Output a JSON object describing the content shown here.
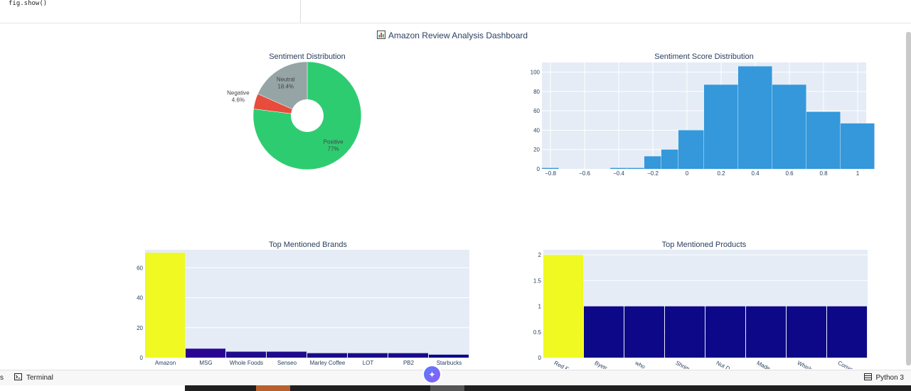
{
  "code": {
    "line": "fig.show()"
  },
  "left_marker": "-",
  "dashboard": {
    "title": "Amazon Review Analysis Dashboard",
    "title_icon": "bar-chart-icon"
  },
  "status_bar": {
    "left_fragment": "s",
    "terminal_label": "Terminal",
    "kernel_label": "Python 3",
    "copilot_icon": "sparkle-icon"
  },
  "chart_data": [
    {
      "type": "pie",
      "title": "Sentiment Distribution",
      "hole": 0.3,
      "slices": [
        {
          "label": "Positive",
          "percent": "77%",
          "value": 77.0,
          "color": "#2ecc71"
        },
        {
          "label": "Negative",
          "percent": "4.6%",
          "value": 4.6,
          "color": "#e74c3c"
        },
        {
          "label": "Neutral",
          "percent": "18.4%",
          "value": 18.4,
          "color": "#95a5a6"
        }
      ]
    },
    {
      "type": "bar",
      "subtype": "histogram",
      "title": "Sentiment Score Distribution",
      "color": "#3498db",
      "xlim": [
        -0.85,
        1.05
      ],
      "ylim": [
        0,
        110
      ],
      "xticks": [
        "−0.8",
        "−0.6",
        "−0.4",
        "−0.2",
        "0",
        "0.2",
        "0.4",
        "0.6",
        "0.8",
        "1"
      ],
      "xtick_values": [
        -0.8,
        -0.6,
        -0.4,
        -0.2,
        0,
        0.2,
        0.4,
        0.6,
        0.8,
        1
      ],
      "yticks": [
        "0",
        "20",
        "40",
        "60",
        "80",
        "100"
      ],
      "ytick_values": [
        0,
        20,
        40,
        60,
        80,
        100
      ],
      "bins": [
        {
          "x0": -0.85,
          "x1": -0.75,
          "y": 1
        },
        {
          "x0": -0.45,
          "x1": -0.35,
          "y": 1
        },
        {
          "x0": -0.35,
          "x1": -0.25,
          "y": 1
        },
        {
          "x0": -0.25,
          "x1": -0.15,
          "y": 13
        },
        {
          "x0": -0.15,
          "x1": -0.05,
          "y": 20
        },
        {
          "x0": -0.05,
          "x1": 0.1,
          "y": 40
        },
        {
          "x0": 0.1,
          "x1": 0.3,
          "y": 87
        },
        {
          "x0": 0.3,
          "x1": 0.5,
          "y": 106
        },
        {
          "x0": 0.5,
          "x1": 0.7,
          "y": 87
        },
        {
          "x0": 0.7,
          "x1": 0.9,
          "y": 59
        },
        {
          "x0": 0.9,
          "x1": 1.1,
          "y": 47
        }
      ],
      "note_bins": "approximate, read from image"
    },
    {
      "type": "bar",
      "title": "Top Mentioned Brands",
      "categories": [
        "Amazon",
        "MSG",
        "Whole Foods",
        "Senseo",
        "Marley Coffee",
        "LOT",
        "PB2",
        "Starbucks"
      ],
      "values": [
        70,
        6,
        4,
        4,
        3,
        3,
        3,
        2
      ],
      "colors": [
        "#f0f921",
        "#2a0593",
        "#1f0c8c",
        "#1f0c8c",
        "#180c8a",
        "#180c8a",
        "#180c8a",
        "#0d0887"
      ],
      "ylim": [
        0,
        72
      ],
      "yticks": [
        "0",
        "20",
        "40",
        "60"
      ],
      "ytick_values": [
        0,
        20,
        40,
        60
      ]
    },
    {
      "type": "bar",
      "title": "Top Mentioned Products",
      "categories": [
        "Red F",
        "Byetr",
        "who",
        "Shrim",
        "Nut D",
        "Made",
        "Whisk",
        "Conve"
      ],
      "values": [
        2,
        1,
        1,
        1,
        1,
        1,
        1,
        1
      ],
      "colors": [
        "#f0f921",
        "#0d0887",
        "#0d0887",
        "#0d0887",
        "#0d0887",
        "#0d0887",
        "#0d0887",
        "#0d0887"
      ],
      "ylim": [
        0,
        2.1
      ],
      "yticks": [
        "0",
        "0.5",
        "1",
        "1.5",
        "2"
      ],
      "ytick_values": [
        0,
        0.5,
        1,
        1.5,
        2
      ]
    }
  ]
}
